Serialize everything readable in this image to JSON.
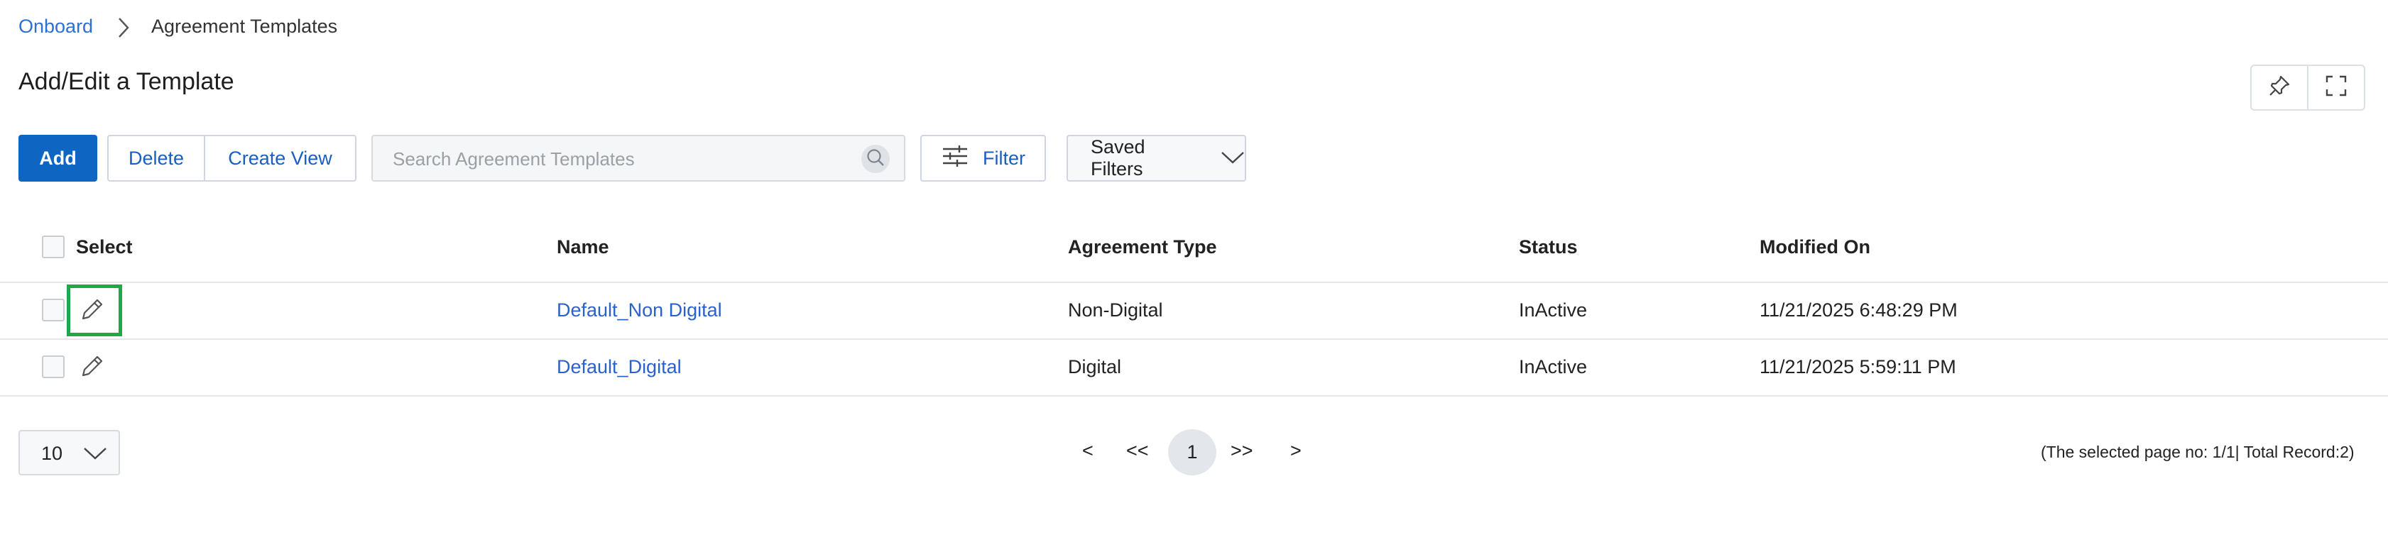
{
  "breadcrumb": {
    "parent": "Onboard",
    "current": "Agreement Templates"
  },
  "page_title": "Add/Edit a Template",
  "toolbar": {
    "add_label": "Add",
    "delete_label": "Delete",
    "create_view_label": "Create View",
    "search_placeholder": "Search Agreement Templates",
    "search_value": "",
    "filter_label": "Filter",
    "saved_filters_label": "Saved Filters"
  },
  "table": {
    "headers": {
      "select": "Select",
      "name": "Name",
      "agreement_type": "Agreement Type",
      "status": "Status",
      "modified_on": "Modified On"
    },
    "rows": [
      {
        "name": "Default_Non Digital",
        "agreement_type": "Non-Digital",
        "status": "InActive",
        "modified_on": "11/21/2025 6:48:29 PM"
      },
      {
        "name": "Default_Digital",
        "agreement_type": "Digital",
        "status": "InActive",
        "modified_on": "11/21/2025 5:59:11 PM"
      }
    ]
  },
  "pagination": {
    "page_size": "10",
    "prev": "<",
    "first": "<<",
    "current_page": "1",
    "last": ">>",
    "next": ">",
    "summary": "(The selected page no: 1/1| Total Record:2)"
  },
  "icons": {
    "breadcrumb_separator": "chevron-right-icon",
    "pin": "pin-icon",
    "expand": "fullscreen-icon",
    "search": "search-icon",
    "filter": "sliders-icon",
    "dropdown": "chevron-down-icon",
    "edit": "pencil-icon"
  },
  "colors": {
    "primary": "#0f65c2",
    "link": "#2a62c9",
    "highlight": "#1fa84a"
  }
}
